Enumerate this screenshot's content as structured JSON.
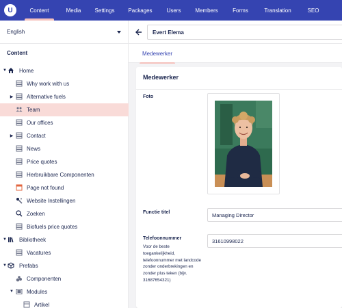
{
  "topnav": {
    "logo": "U",
    "items": [
      {
        "label": "Content",
        "active": true
      },
      {
        "label": "Media"
      },
      {
        "label": "Settings"
      },
      {
        "label": "Packages"
      },
      {
        "label": "Users"
      },
      {
        "label": "Members"
      },
      {
        "label": "Forms"
      },
      {
        "label": "Translation"
      },
      {
        "label": "SEO"
      }
    ]
  },
  "sidebar": {
    "language": "English",
    "section_title": "Content",
    "tree": [
      {
        "label": "Home",
        "icon": "home-icon",
        "expander": "expanded"
      },
      {
        "label": "Why work with us",
        "icon": "document-icon"
      },
      {
        "label": "Alternative fuels",
        "icon": "document-icon",
        "expander": "collapsed"
      },
      {
        "label": "Team",
        "icon": "team-icon",
        "selected": true
      },
      {
        "label": "Our offices",
        "icon": "document-icon"
      },
      {
        "label": "Contact",
        "icon": "document-icon",
        "expander": "collapsed"
      },
      {
        "label": "News",
        "icon": "document-icon"
      },
      {
        "label": "Price quotes",
        "icon": "document-icon"
      },
      {
        "label": "Herbruikbare Componenten",
        "icon": "document-icon"
      },
      {
        "label": "Page not found",
        "icon": "error-page-icon"
      },
      {
        "label": "Website Instellingen",
        "icon": "settings-icon"
      },
      {
        "label": "Zoeken",
        "icon": "search-icon"
      },
      {
        "label": "Biofuels price quotes",
        "icon": "document-icon"
      },
      {
        "label": "Bibliotheek",
        "icon": "library-icon",
        "expander": "expanded"
      },
      {
        "label": "Vacatures",
        "icon": "document-icon"
      },
      {
        "label": "Prefabs",
        "icon": "prefabs-icon",
        "expander": "expanded"
      },
      {
        "label": "Componenten",
        "icon": "components-icon"
      },
      {
        "label": "Modules",
        "icon": "modules-icon",
        "expander": "expanded"
      },
      {
        "label": "Artikel",
        "icon": "document-icon"
      }
    ]
  },
  "editor": {
    "node_name": "Evert Elema",
    "tab": "Medewerker",
    "panel_title": "Medewerker",
    "properties": {
      "photo": {
        "label": "Foto"
      },
      "job_title": {
        "label": "Functie titel",
        "value": "Managing Director"
      },
      "phone": {
        "label": "Telefoonnummer",
        "description": "Voor de beste toegankelijkheid, telefoonnummer met landcode zonder onderbrekingen en zonder plus teken (bijv. 31687654321)",
        "value": "31610998022"
      }
    }
  },
  "colors": {
    "topbar": "#3544b1",
    "accent_pink": "#f5c1bc",
    "selected_row": "#f9dbd8",
    "text_dark": "#1b264f"
  }
}
